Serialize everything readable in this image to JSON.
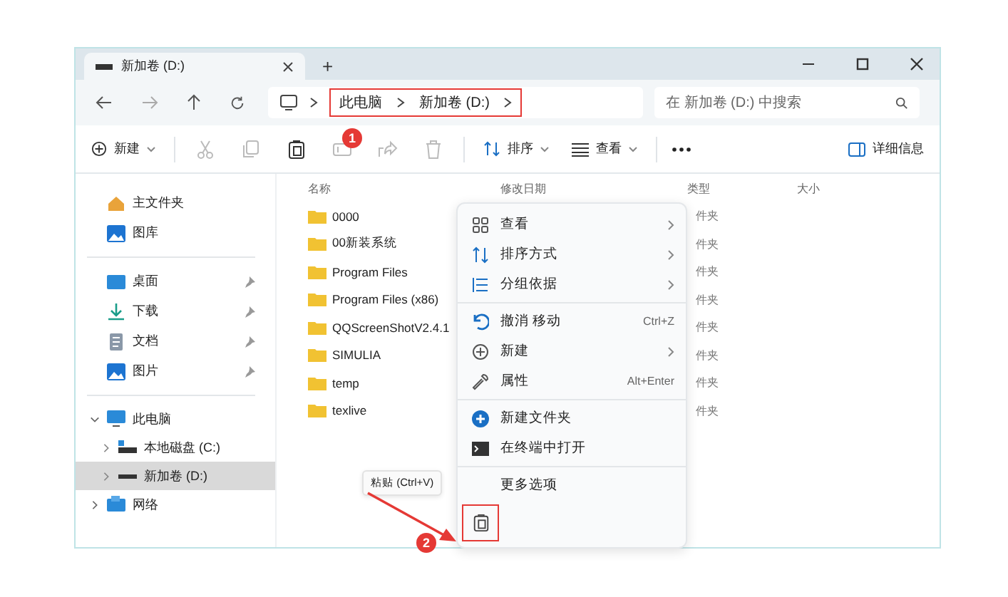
{
  "window": {
    "tab_title": "新加卷 (D:)",
    "new_tab": "+"
  },
  "nav": {
    "breadcrumb": [
      "此电脑",
      "新加卷 (D:)"
    ],
    "search": {
      "placeholder": "在 新加卷 (D:) 中搜索"
    }
  },
  "toolbar": {
    "new_label": "新建",
    "items": [
      {
        "kind": "cut",
        "disabled": true
      },
      {
        "kind": "copy",
        "disabled": true
      },
      {
        "kind": "paste",
        "disabled": false
      },
      {
        "kind": "rename",
        "disabled": true
      },
      {
        "kind": "share",
        "disabled": true
      },
      {
        "kind": "delete",
        "disabled": true
      }
    ],
    "sort_label": "排序",
    "view_label": "查看",
    "details_label": "详细信息"
  },
  "sidebar": {
    "quick": [
      {
        "label": "主文件夹",
        "kind": "home"
      },
      {
        "label": "图库",
        "kind": "gallery"
      }
    ],
    "pinned": [
      {
        "label": "桌面",
        "kind": "desktop",
        "pinned": true
      },
      {
        "label": "下载",
        "kind": "download",
        "pinned": true
      },
      {
        "label": "文档",
        "kind": "document",
        "pinned": true
      },
      {
        "label": "图片",
        "kind": "gallery",
        "pinned": true
      }
    ],
    "tree": [
      {
        "label": "此电脑",
        "kind": "pc",
        "expanded": true,
        "selected": false,
        "children": [
          {
            "label": "本地磁盘 (C:)",
            "kind": "disk",
            "expanded": false,
            "selected": false
          },
          {
            "label": "新加卷 (D:)",
            "kind": "drive",
            "expanded": false,
            "selected": true
          }
        ]
      },
      {
        "label": "网络",
        "kind": "network",
        "expanded": false,
        "selected": false
      }
    ]
  },
  "file_list": {
    "columns": [
      "名称",
      "修改日期",
      "类型",
      "大小"
    ],
    "rows": [
      {
        "name": "0000",
        "type": "件夹"
      },
      {
        "name": "00新装系统",
        "type": "件夹"
      },
      {
        "name": "Program Files",
        "type": "件夹"
      },
      {
        "name": "Program Files (x86)",
        "type": "件夹"
      },
      {
        "name": "QQScreenShotV2.4.1",
        "type": "件夹"
      },
      {
        "name": "SIMULIA",
        "type": "件夹"
      },
      {
        "name": "temp",
        "type": "件夹"
      },
      {
        "name": "texlive",
        "type": "件夹"
      }
    ]
  },
  "context_menu": {
    "groups": [
      [
        {
          "kind": "view",
          "label": "查看",
          "submenu": true
        },
        {
          "kind": "sort",
          "label": "排序方式",
          "submenu": true
        },
        {
          "kind": "group",
          "label": "分组依据",
          "submenu": true
        }
      ],
      [
        {
          "kind": "undo",
          "label": "撤消 移动",
          "shortcut": "Ctrl+Z"
        },
        {
          "kind": "new",
          "label": "新建",
          "submenu": true
        },
        {
          "kind": "properties",
          "label": "属性",
          "shortcut": "Alt+Enter"
        }
      ],
      [
        {
          "kind": "new-folder",
          "label": "新建文件夹"
        },
        {
          "kind": "terminal",
          "label": "在终端中打开"
        }
      ],
      [
        {
          "label": "更多选项"
        }
      ]
    ],
    "paste_tooltip": "粘贴 (Ctrl+V)"
  },
  "annotations": [
    {
      "kind": "badge",
      "label": "1"
    },
    {
      "kind": "badge",
      "label": "2"
    }
  ]
}
